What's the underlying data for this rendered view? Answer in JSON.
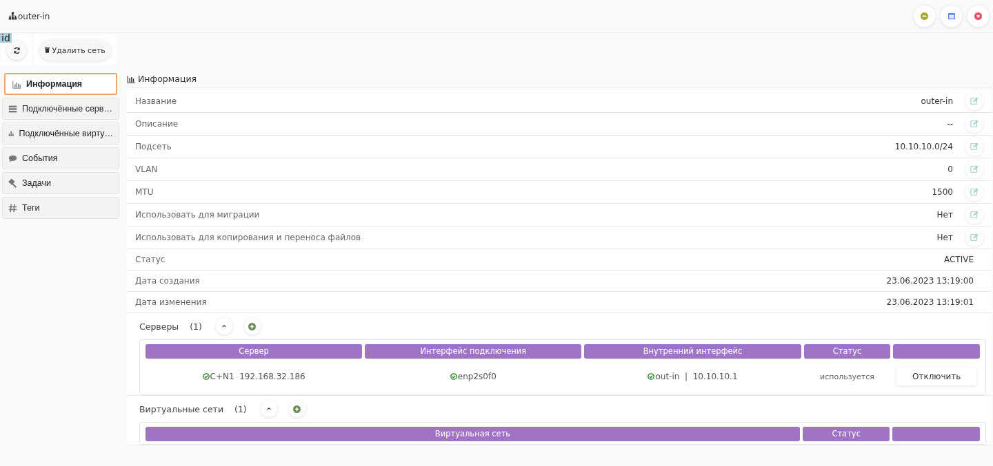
{
  "window": {
    "title": "outer-in"
  },
  "debug_label": "id",
  "toolbar": {
    "delete_button": "Удалить сеть"
  },
  "sidebar": {
    "items": [
      {
        "label": "Информация",
        "selected": true
      },
      {
        "label": "Подключённые серв…",
        "selected": false
      },
      {
        "label": "Подключённые вирту…",
        "selected": false
      },
      {
        "label": "События",
        "selected": false
      },
      {
        "label": "Задачи",
        "selected": false
      },
      {
        "label": "Теги",
        "selected": false
      }
    ]
  },
  "info": {
    "title": "Информация",
    "rows": [
      {
        "label": "Название",
        "value": "outer-in",
        "editable": true
      },
      {
        "label": "Описание",
        "value": "--",
        "editable": true
      },
      {
        "label": "Подсеть",
        "value": "10.10.10.0/24",
        "editable": true
      },
      {
        "label": "VLAN",
        "value": "0",
        "editable": true
      },
      {
        "label": "MTU",
        "value": "1500",
        "editable": true
      },
      {
        "label": "Использовать для миграции",
        "value": "Нет",
        "editable": true
      },
      {
        "label": "Использовать для копирования и переноса файлов",
        "value": "Нет",
        "editable": true
      },
      {
        "label": "Статус",
        "value": "ACTIVE",
        "editable": false
      },
      {
        "label": "Дата создания",
        "value": "23.06.2023 13:19:00",
        "editable": false
      },
      {
        "label": "Дата изменения",
        "value": "23.06.2023 13:19:01",
        "editable": false
      }
    ]
  },
  "sections": [
    {
      "title": "Серверы",
      "count": "(1)",
      "expanded": true,
      "columns": [
        {
          "kind": "text",
          "label": "Сервер"
        },
        {
          "kind": "text",
          "label": "Интерфейс подключения"
        },
        {
          "kind": "text",
          "label": "Внутренний интерфейс"
        },
        {
          "kind": "text",
          "label": "Статус"
        },
        {
          "kind": "actions"
        }
      ],
      "rows": [
        {
          "cells": [
            {
              "kind": "ok",
              "text": "C+N1  192.168.32.186"
            },
            {
              "kind": "ok",
              "text": "enp2s0f0"
            },
            {
              "kind": "ok",
              "text": "out-in  |  10.10.10.1"
            },
            {
              "kind": "status",
              "text": "используется"
            },
            {
              "kind": "button",
              "text": "Отключить"
            }
          ]
        }
      ]
    },
    {
      "title": "Виртуальные сети",
      "count": "(1)",
      "expanded": true,
      "columns": [
        {
          "kind": "text",
          "label": "Виртуальная сеть"
        },
        {
          "kind": "text",
          "label": "Статус"
        },
        {
          "kind": "actions"
        }
      ]
    }
  ]
}
